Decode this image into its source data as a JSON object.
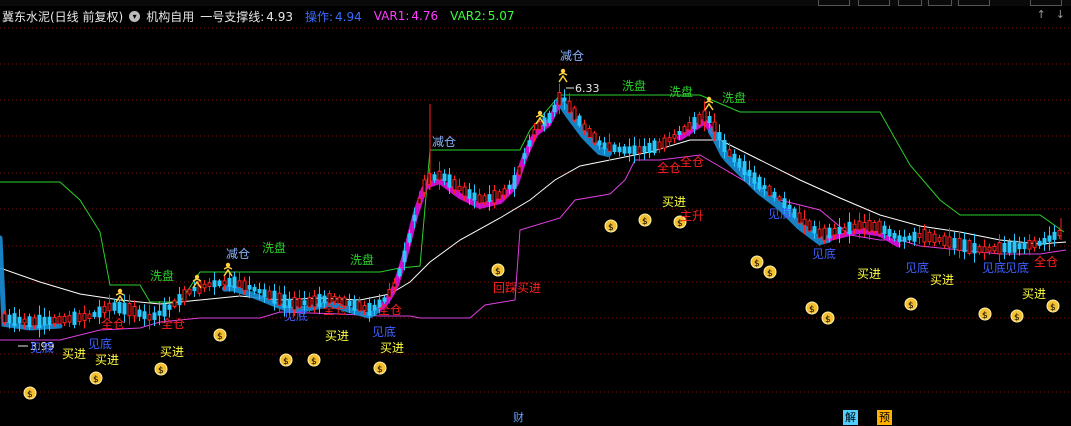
{
  "header": {
    "title": "冀东水泥(日线 前复权)",
    "indicator_name": "机构自用",
    "support_label": "一号支撑线:",
    "support_value": "4.93",
    "op_label": "操作:",
    "op_value": "4.94",
    "var1_label": "VAR1:",
    "var1_value": "4.76",
    "var2_label": "VAR2:",
    "var2_value": "5.07"
  },
  "window_controls": [
    "↑",
    "↓"
  ],
  "annotations": {
    "high_price": "6.33",
    "low_price": "3.99",
    "reduce": "减仓",
    "wash": "洗盘",
    "full": "全仓",
    "bottom": "见底",
    "buy": "买进",
    "pullback_buy": "回踩买进",
    "main_up": "主升"
  },
  "bottom_tags": {
    "fin": "财",
    "jie": "解",
    "yu": "预"
  },
  "colors": {
    "up": "#ff2020",
    "down": "#28c8ff",
    "support_line": "#e040e0",
    "resistance_line": "#2ad02a",
    "ma_line": "#ffffff",
    "grid": "#7a1010",
    "buy_text": "#ffff40",
    "bottom_text": "#4060ff",
    "full_text": "#ff2020"
  },
  "icons": [
    "money-bag-icon",
    "runner-icon",
    "menu-circle-icon"
  ]
}
